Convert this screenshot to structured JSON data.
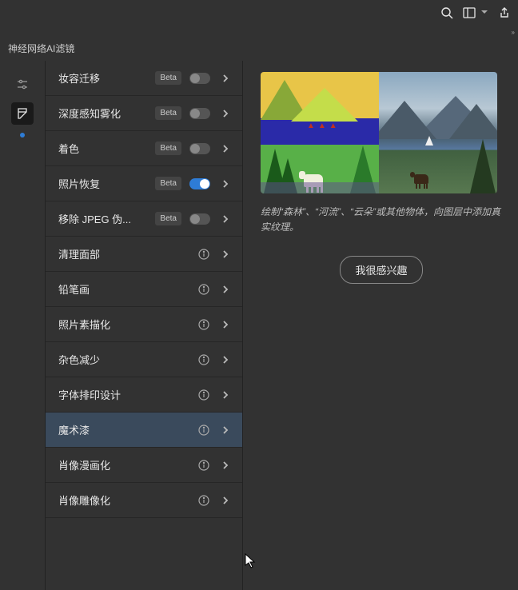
{
  "panel": {
    "title": "神经网络AI滤镜"
  },
  "sidebar": {
    "items": [
      {
        "name": "adjustments"
      },
      {
        "name": "filters"
      }
    ]
  },
  "filters": [
    {
      "label": "妆容迁移",
      "badge": "Beta",
      "beta": true,
      "toggle": false
    },
    {
      "label": "深度感知雾化",
      "badge": "Beta",
      "beta": true,
      "toggle": false
    },
    {
      "label": "着色",
      "badge": "Beta",
      "beta": true,
      "toggle": false
    },
    {
      "label": "照片恢复",
      "badge": "Beta",
      "beta": true,
      "toggle": true
    },
    {
      "label": "移除 JPEG 伪...",
      "badge": "Beta",
      "beta": true,
      "toggle": false
    },
    {
      "label": "清理面部",
      "beta": false
    },
    {
      "label": "铅笔画",
      "beta": false
    },
    {
      "label": "照片素描化",
      "beta": false
    },
    {
      "label": "杂色减少",
      "beta": false
    },
    {
      "label": "字体排印设计",
      "beta": false
    },
    {
      "label": "魔术漆",
      "beta": false,
      "selected": true
    },
    {
      "label": "肖像漫画化",
      "beta": false
    },
    {
      "label": "肖像雕像化",
      "beta": false
    }
  ],
  "detail": {
    "description": "绘制“森林”、“河流”、“云朵”或其他物体，向图层中添加真实纹理。",
    "interest_label": "我很感兴趣"
  }
}
